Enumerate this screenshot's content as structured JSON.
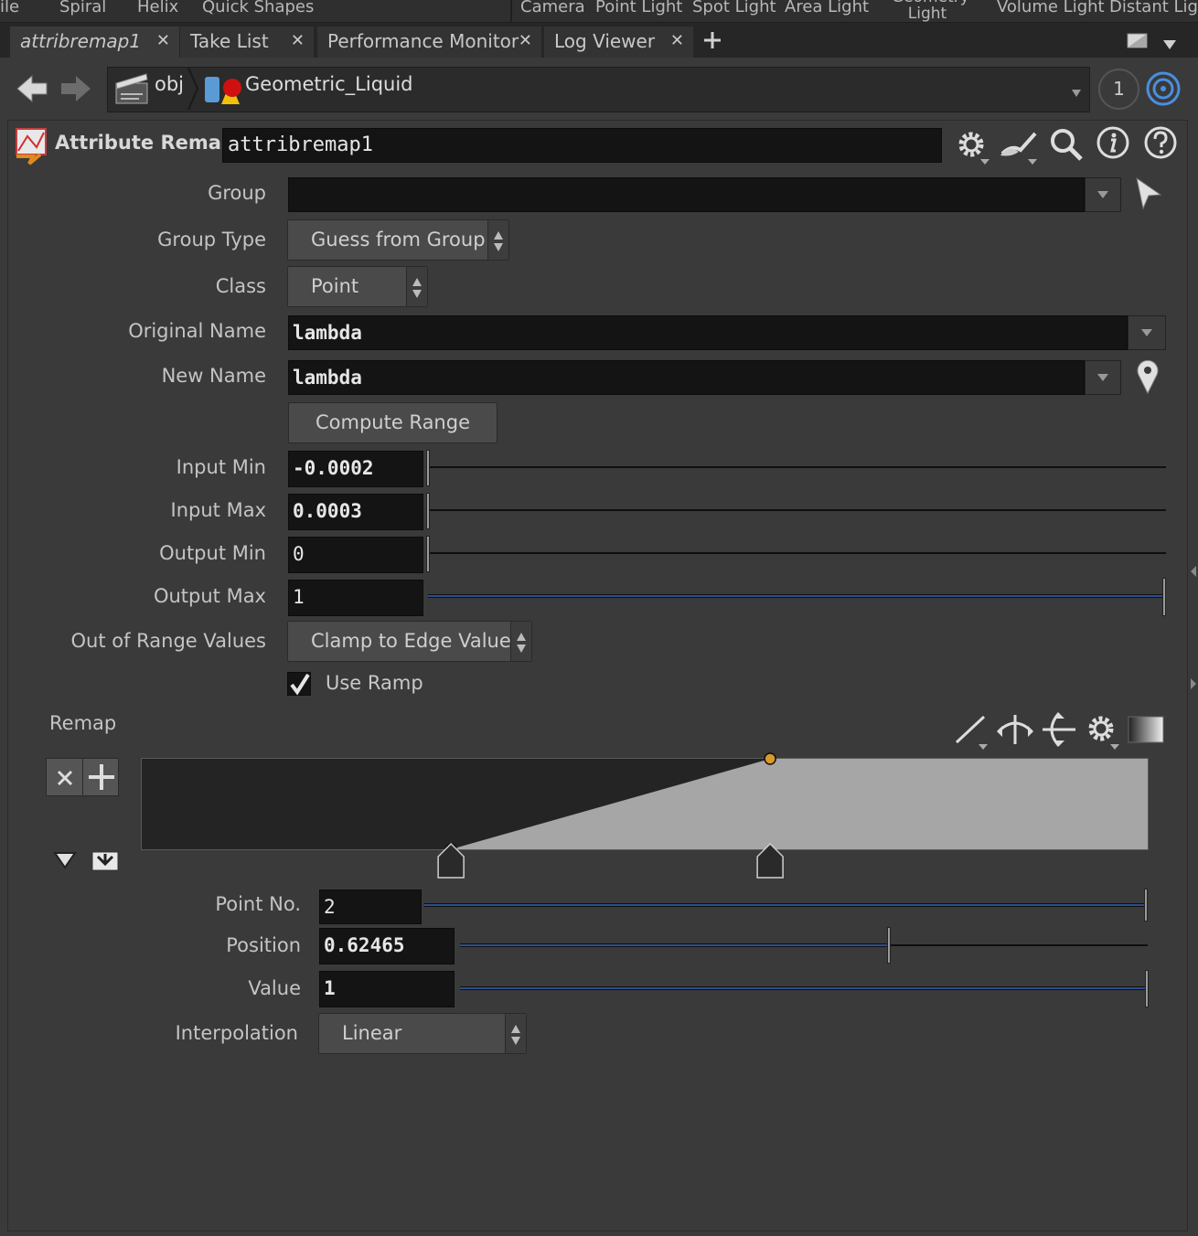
{
  "shelf": {
    "items": [
      "ile",
      "Spiral",
      "Helix",
      "Quick Shapes",
      "Camera",
      "Point Light",
      "Spot Light",
      "Area Light",
      "Geometry Light",
      "Volume Light",
      "Distant Light"
    ]
  },
  "tabs": [
    {
      "label": "attribremap1",
      "active": true
    },
    {
      "label": "Take List",
      "active": false
    },
    {
      "label": "Performance Monitor",
      "active": false
    },
    {
      "label": "Log Viewer",
      "active": false
    }
  ],
  "path": {
    "root": "obj",
    "node": "Geometric_Liquid",
    "pane_number": "1"
  },
  "node_header": {
    "type_label": "Attribute Remap",
    "name": "attribremap1"
  },
  "params": {
    "group": {
      "label": "Group",
      "value": ""
    },
    "group_type": {
      "label": "Group Type",
      "value": "Guess from Group"
    },
    "class": {
      "label": "Class",
      "value": "Point"
    },
    "original_name": {
      "label": "Original Name",
      "value": "lambda"
    },
    "new_name": {
      "label": "New Name",
      "value": "lambda"
    },
    "compute_range": {
      "label": "Compute Range"
    },
    "input_min": {
      "label": "Input Min",
      "value": "-0.0002"
    },
    "input_max": {
      "label": "Input Max",
      "value": "0.0003"
    },
    "output_min": {
      "label": "Output Min",
      "value": "0"
    },
    "output_max": {
      "label": "Output Max",
      "value": "1"
    },
    "out_of_range": {
      "label": "Out of Range Values",
      "value": "Clamp to Edge Value"
    },
    "use_ramp": {
      "label": "Use Ramp",
      "checked": true
    }
  },
  "ramp": {
    "label": "Remap",
    "keys": [
      {
        "position": 0.3074,
        "value": 0
      },
      {
        "position": 0.62465,
        "value": 1
      }
    ],
    "selected_key": 2,
    "colors": {
      "fill": "#a6a6a6",
      "background": "#242424",
      "selected_key": "#d89a2a",
      "key": "#111111"
    }
  },
  "ramp_params": {
    "point_no": {
      "label": "Point No.",
      "value": "2",
      "fraction": 1.0
    },
    "position": {
      "label": "Position",
      "value": "0.62465",
      "fraction": 0.62465
    },
    "value": {
      "label": "Value",
      "value": "1",
      "fraction": 1.0
    },
    "interpolation": {
      "label": "Interpolation",
      "value": "Linear"
    }
  }
}
